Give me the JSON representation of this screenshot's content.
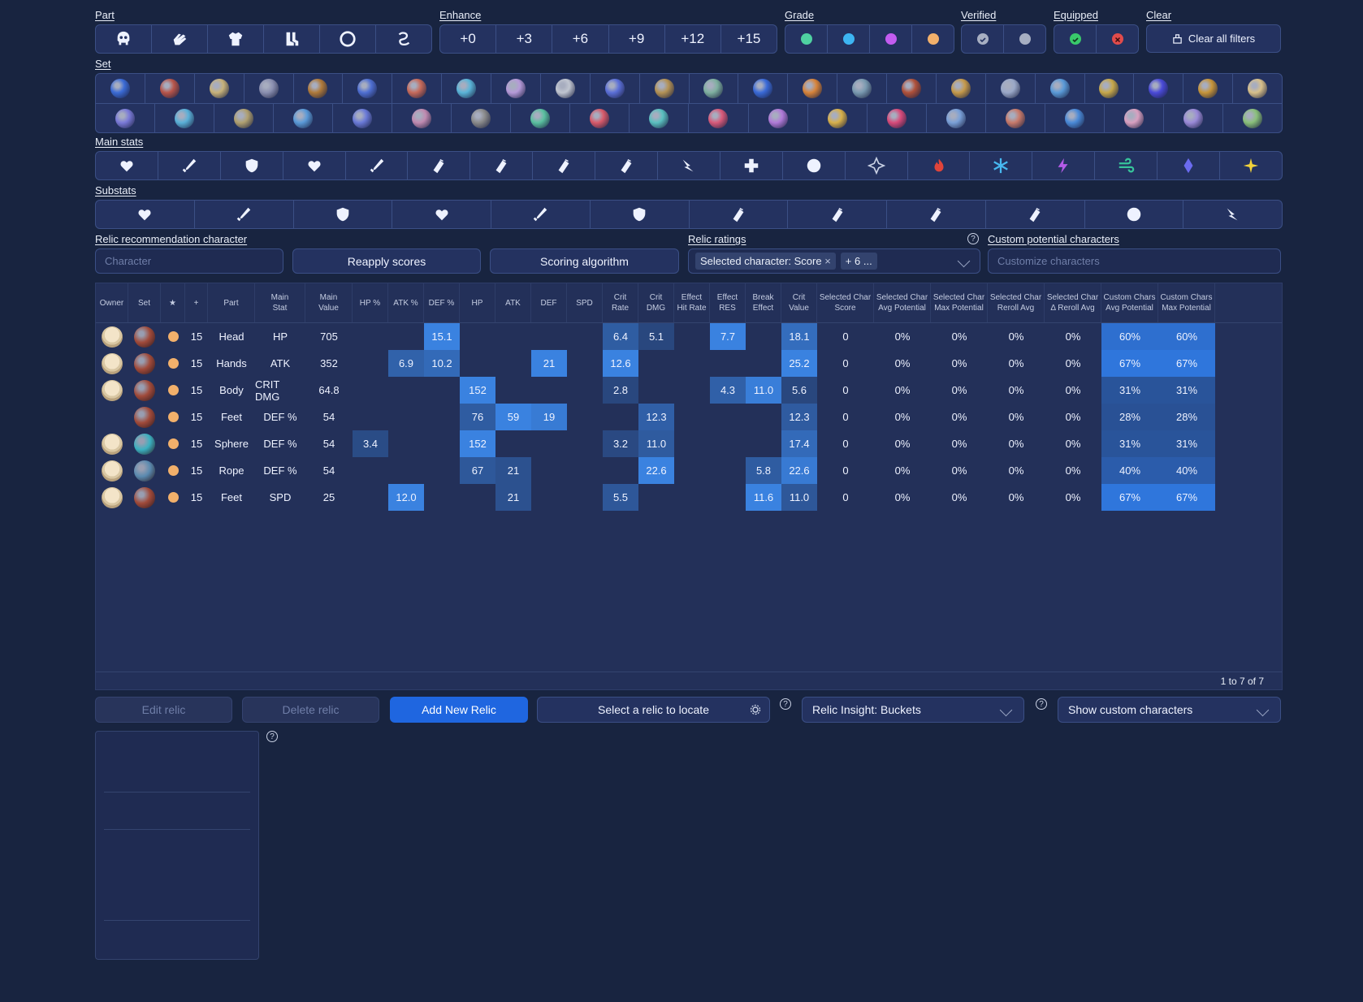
{
  "filters": {
    "part_label": "Part",
    "part_icons": [
      "head-icon",
      "hands-icon",
      "body-icon",
      "feet-icon",
      "sphere-icon",
      "rope-icon"
    ],
    "enhance_label": "Enhance",
    "enhance": [
      "+0",
      "+3",
      "+6",
      "+9",
      "+12",
      "+15"
    ],
    "grade_label": "Grade",
    "grade_colors": [
      "#4fd1a1",
      "#3db5f2",
      "#c35cf0",
      "#f2b06b"
    ],
    "verified_label": "Verified",
    "equipped_label": "Equipped",
    "clear_label": "Clear",
    "clear_all": "Clear all filters",
    "set_label": "Set",
    "set_row1_colors": [
      "#3b6bd6",
      "#b8554a",
      "#c7b27a",
      "#8a8fb0",
      "#b07a3a",
      "#4f6fd2",
      "#c76a5a",
      "#5ab4d8",
      "#b59ad8",
      "#c0c5d0",
      "#5b6fd8",
      "#b49255",
      "#7fb0a0",
      "#3a6ad8",
      "#d8843a",
      "#7a9ab0",
      "#b0513a",
      "#c69a4a",
      "#9aa8c8",
      "#5a9ad8",
      "#c7a84a",
      "#4a4ad8",
      "#c7953a",
      "#d8c08a"
    ],
    "set_row2_colors": [
      "#7a7ad8",
      "#5ab0d8",
      "#b0a070",
      "#5a9ad8",
      "#6a7ad8",
      "#c08ab0",
      "#8a8a8a",
      "#5ac0a0",
      "#d85a6a",
      "#5ac0c0",
      "#d85a7a",
      "#b07ad8",
      "#d8b04a",
      "#d84a7a",
      "#7aa0d8",
      "#c87a6a",
      "#4a8ad8",
      "#d8a0c0",
      "#9a8ad8",
      "#8ac07a"
    ],
    "mainstats_label": "Main stats",
    "mainstat_icons": [
      "hp-percent-icon",
      "atk-percent-icon",
      "def-percent-icon",
      "hp-icon",
      "atk-icon",
      "crit-rate-icon",
      "crit-dmg-icon",
      "effect-hit-icon",
      "effect-res-icon",
      "speed-icon",
      "healing-icon",
      "break-icon",
      "physical-icon",
      "fire-icon",
      "ice-icon",
      "lightning-icon",
      "wind-icon",
      "quantum-icon",
      "imaginary-icon"
    ],
    "substats_label": "Substats",
    "substat_icons": [
      "hp-percent-icon",
      "atk-percent-icon",
      "def-percent-icon",
      "hp-icon",
      "atk-icon",
      "def-icon",
      "crit-rate-icon",
      "crit-dmg-icon",
      "effect-hit-icon",
      "effect-res-icon",
      "break-icon",
      "speed-icon"
    ]
  },
  "controls": {
    "rec_char_label": "Relic recommendation character",
    "character_placeholder": "Character",
    "reapply": "Reapply scores",
    "scoring": "Scoring algorithm",
    "ratings_label": "Relic ratings",
    "ratings_tag": "Selected character: Score",
    "ratings_more": "+ 6 ...",
    "custom_label": "Custom potential characters",
    "customize_placeholder": "Customize characters"
  },
  "table": {
    "headers": [
      "Owner",
      "Set",
      "★",
      "+",
      "Part",
      "Main\nStat",
      "Main\nValue",
      "HP %",
      "ATK %",
      "DEF %",
      "HP",
      "ATK",
      "DEF",
      "SPD",
      "Crit\nRate",
      "Crit\nDMG",
      "Effect\nHit Rate",
      "Effect\nRES",
      "Break\nEffect",
      "Crit\nValue",
      "Selected Char\nScore",
      "Selected Char\nAvg Potential",
      "Selected Char\nMax Potential",
      "Selected Char\nReroll Avg",
      "Selected Char\nΔ Reroll Avg",
      "Custom Chars\nAvg Potential",
      "Custom Chars\nMax Potential"
    ],
    "rows": [
      {
        "owner": true,
        "set": "#a04a3a",
        "enh": "15",
        "part": "Head",
        "main": "HP",
        "mv": "705",
        "hpp": "",
        "atkp": "",
        "defp": "15.1",
        "hp": "",
        "atk": "",
        "def": "",
        "spd": "",
        "cr": "6.4",
        "cd": "5.1",
        "ehr": "",
        "res": "7.7",
        "be": "",
        "cv": "18.1",
        "score": "0",
        "avg": "0%",
        "max": "0%",
        "rr": "0%",
        "drr": "0%",
        "cavg": "60%",
        "cmax": "60%"
      },
      {
        "owner": true,
        "set": "#a04a3a",
        "enh": "15",
        "part": "Hands",
        "main": "ATK",
        "mv": "352",
        "hpp": "",
        "atkp": "6.9",
        "defp": "10.2",
        "hp": "",
        "atk": "",
        "def": "21",
        "spd": "",
        "cr": "12.6",
        "cd": "",
        "ehr": "",
        "res": "",
        "be": "",
        "cv": "25.2",
        "score": "0",
        "avg": "0%",
        "max": "0%",
        "rr": "0%",
        "drr": "0%",
        "cavg": "67%",
        "cmax": "67%"
      },
      {
        "owner": true,
        "set": "#a04a3a",
        "enh": "15",
        "part": "Body",
        "main": "CRIT DMG",
        "mv": "64.8",
        "hpp": "",
        "atkp": "",
        "defp": "",
        "hp": "152",
        "atk": "",
        "def": "",
        "spd": "",
        "cr": "2.8",
        "cd": "",
        "ehr": "",
        "res": "4.3",
        "be": "11.0",
        "cv": "5.6",
        "score": "0",
        "avg": "0%",
        "max": "0%",
        "rr": "0%",
        "drr": "0%",
        "cavg": "31%",
        "cmax": "31%"
      },
      {
        "owner": false,
        "set": "#a04a3a",
        "enh": "15",
        "part": "Feet",
        "main": "DEF %",
        "mv": "54",
        "hpp": "",
        "atkp": "",
        "defp": "",
        "hp": "76",
        "atk": "59",
        "def": "19",
        "spd": "",
        "cr": "",
        "cd": "12.3",
        "ehr": "",
        "res": "",
        "be": "",
        "cv": "12.3",
        "score": "0",
        "avg": "0%",
        "max": "0%",
        "rr": "0%",
        "drr": "0%",
        "cavg": "28%",
        "cmax": "28%"
      },
      {
        "owner": true,
        "set": "#3ab0c0",
        "enh": "15",
        "part": "Sphere",
        "main": "DEF %",
        "mv": "54",
        "hpp": "3.4",
        "atkp": "",
        "defp": "",
        "hp": "152",
        "atk": "",
        "def": "",
        "spd": "",
        "cr": "3.2",
        "cd": "11.0",
        "ehr": "",
        "res": "",
        "be": "",
        "cv": "17.4",
        "score": "0",
        "avg": "0%",
        "max": "0%",
        "rr": "0%",
        "drr": "0%",
        "cavg": "31%",
        "cmax": "31%"
      },
      {
        "owner": true,
        "set": "#5a8ab0",
        "enh": "15",
        "part": "Rope",
        "main": "DEF %",
        "mv": "54",
        "hpp": "",
        "atkp": "",
        "defp": "",
        "hp": "67",
        "atk": "21",
        "def": "",
        "spd": "",
        "cr": "",
        "cd": "22.6",
        "ehr": "",
        "res": "",
        "be": "5.8",
        "cv": "22.6",
        "score": "0",
        "avg": "0%",
        "max": "0%",
        "rr": "0%",
        "drr": "0%",
        "cavg": "40%",
        "cmax": "40%"
      },
      {
        "owner": true,
        "set": "#a04a3a",
        "enh": "15",
        "part": "Feet",
        "main": "SPD",
        "mv": "25",
        "hpp": "",
        "atkp": "12.0",
        "defp": "",
        "hp": "",
        "atk": "21",
        "def": "",
        "spd": "",
        "cr": "5.5",
        "cd": "",
        "ehr": "",
        "res": "",
        "be": "11.6",
        "cv": "11.0",
        "score": "0",
        "avg": "0%",
        "max": "0%",
        "rr": "0%",
        "drr": "0%",
        "cavg": "67%",
        "cmax": "67%"
      }
    ],
    "pagination": "1 to 7 of 7"
  },
  "actions": {
    "edit": "Edit relic",
    "delete": "Delete relic",
    "add": "Add New Relic",
    "locate": "Select a relic to locate",
    "insight": "Relic Insight: Buckets",
    "custom": "Show custom characters"
  }
}
